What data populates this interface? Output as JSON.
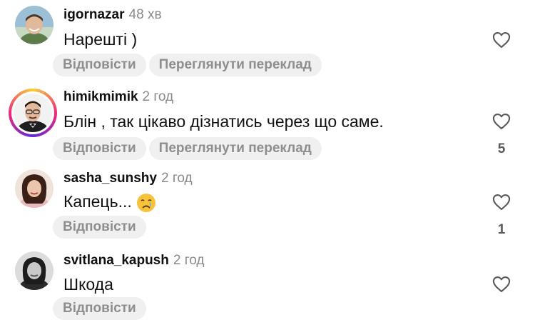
{
  "comments": [
    {
      "username": "igornazar",
      "time": "48 хв",
      "text": "Нарешті )",
      "actions": [
        "Відповісти",
        "Переглянути переклад"
      ],
      "likes": ""
    },
    {
      "username": "himikmimik",
      "time": "2 год",
      "text": "Блін , так цікаво дізнатись через що саме.",
      "actions": [
        "Відповісти",
        "Переглянути переклад"
      ],
      "likes": "5"
    },
    {
      "username": "sasha_sunshy",
      "time": "2 год",
      "text": "Капець...",
      "emoji": "crying-face",
      "actions": [
        "Відповісти"
      ],
      "likes": "1"
    },
    {
      "username": "svitlana_kapush",
      "time": "2 год",
      "text": "Шкода",
      "actions": [
        "Відповісти"
      ],
      "likes": ""
    }
  ],
  "icons": {
    "like": "heart-outline-icon"
  },
  "colors": {
    "story_ring": "#ee2a7b",
    "secondary_text": "#8a8a8a",
    "pill_bg": "#f0f0f0"
  }
}
